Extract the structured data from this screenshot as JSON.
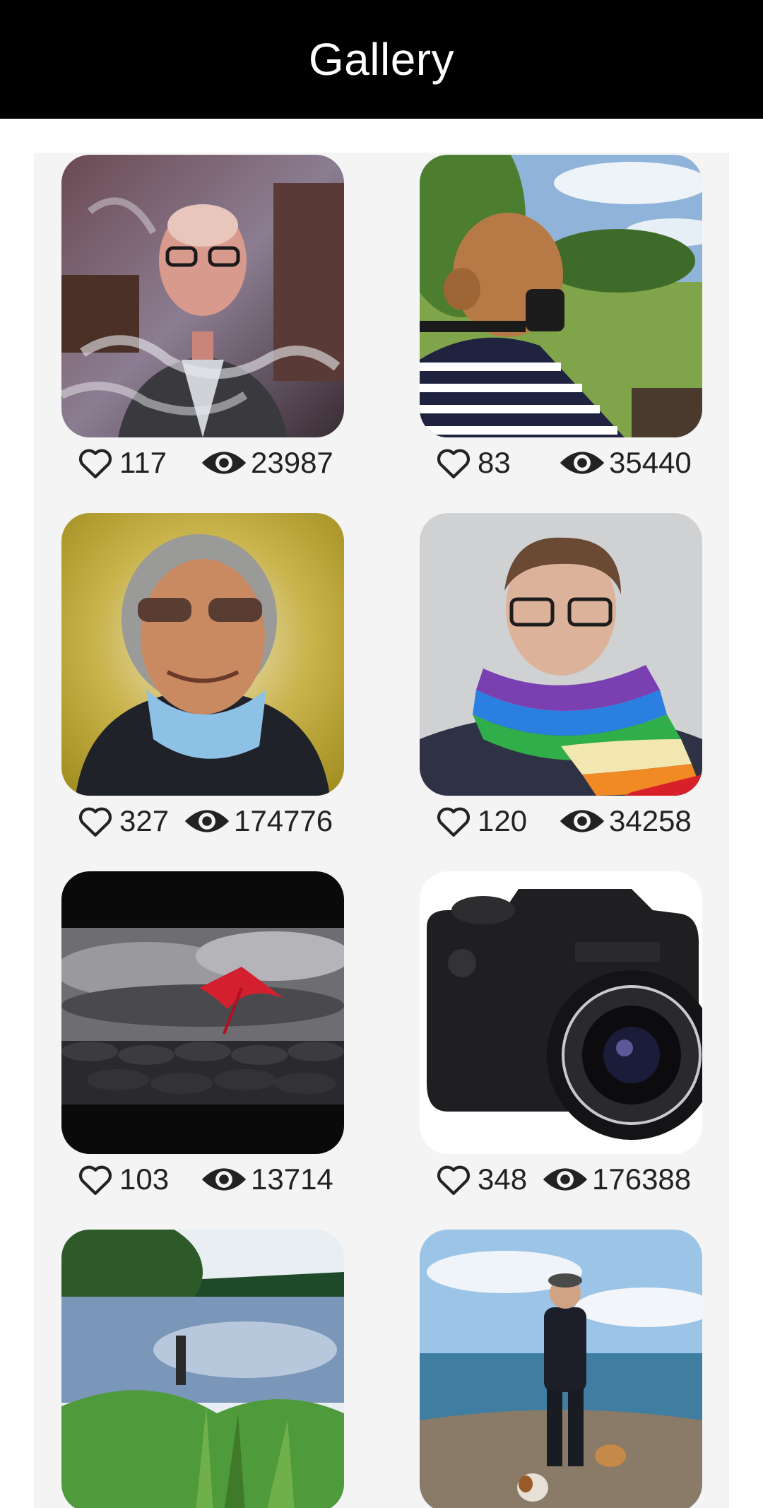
{
  "app_bar": {
    "title": "Gallery"
  },
  "colors": {
    "app_bar_bg": "#000000",
    "panel_bg": "#f4f4f4",
    "text": "#222222"
  },
  "icons": {
    "like": "heart-outline-icon",
    "views": "eye-icon"
  },
  "photos": [
    {
      "subject": "man-in-smoke",
      "likes": "117",
      "views": "23987"
    },
    {
      "subject": "woman-photographer",
      "likes": "83",
      "views": "35440"
    },
    {
      "subject": "man-with-mask",
      "likes": "327",
      "views": "174776"
    },
    {
      "subject": "man-rainbow-scarf",
      "likes": "120",
      "views": "34258"
    },
    {
      "subject": "red-umbrella",
      "likes": "103",
      "views": "13714"
    },
    {
      "subject": "camera",
      "likes": "348",
      "views": "176388"
    },
    {
      "subject": "lake",
      "likes": "",
      "views": ""
    },
    {
      "subject": "man-with-dogs",
      "likes": "",
      "views": ""
    }
  ]
}
